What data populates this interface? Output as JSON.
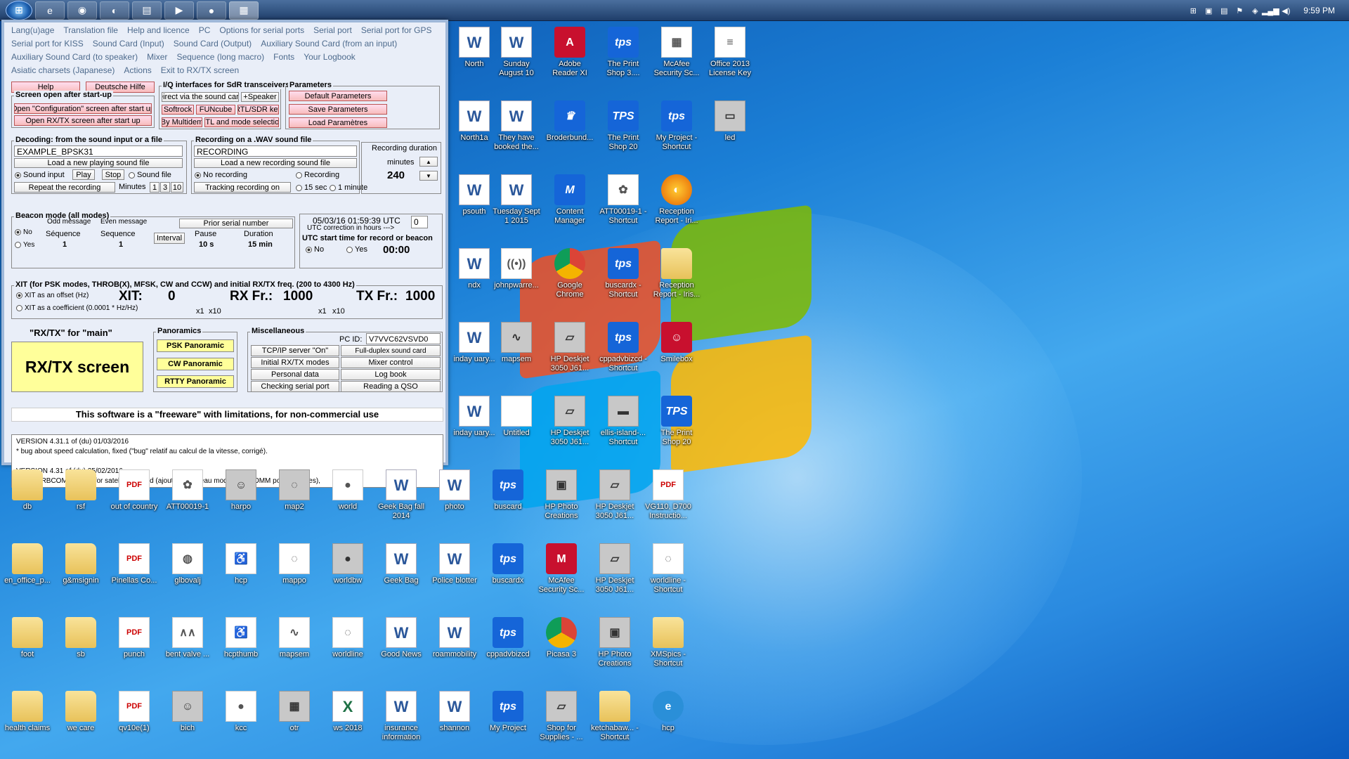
{
  "taskbar": {
    "start_glyph": "⊞",
    "buttons": [
      {
        "icon": "ie-icon",
        "glyph": "e"
      },
      {
        "icon": "chrome-icon",
        "glyph": "◉"
      },
      {
        "icon": "firefox-icon",
        "glyph": "◐"
      },
      {
        "icon": "explorer-icon",
        "glyph": "▤"
      },
      {
        "icon": "media-player-icon",
        "glyph": "▶"
      },
      {
        "icon": "disc-icon",
        "glyph": "●"
      },
      {
        "icon": "multipsk-icon",
        "glyph": "▦"
      }
    ],
    "clock": "9:59 PM"
  },
  "app": {
    "menu": [
      "Lang(u)age",
      "Translation file",
      "Help and licence",
      "PC",
      "Options for serial ports",
      "Serial port",
      "Serial port for GPS",
      "Serial port for KISS",
      "Sound Card (Input)",
      "Sound Card (Output)",
      "Auxiliary Sound Card (from an input)",
      "Auxiliary Sound Card (to speaker)",
      "Mixer",
      "Sequence (long macro)",
      "Fonts",
      "Your Logbook",
      "Asiatic charsets (Japanese)",
      "Actions",
      "Exit to RX/TX screen"
    ],
    "help": "Help",
    "deutsche": "Deutsche Hilfe",
    "screen_open": {
      "title": "Screen open after start-up",
      "config": "Open \"Configuration\" screen after start up",
      "rxtx": "Open RX/TX screen after start up"
    },
    "iq": {
      "title": "I/Q interfaces for SdR transceivers",
      "direct": "Direct via the sound card",
      "speaker": "+Speaker",
      "softrock": "Softrock",
      "funcube": "FUNcube",
      "rtl": "RTL/SDR key",
      "multidem": "By Multidem",
      "rtl_mode": "RTL and mode selection"
    },
    "params": {
      "title": "Parameters",
      "default": "Default Parameters",
      "save": "Save Parameters",
      "load": "Load Paramètres"
    },
    "decoding": {
      "title": "Decoding: from the sound input or a file",
      "file": "EXAMPLE_BPSK31",
      "load": "Load a new playing sound file",
      "sound_input": "Sound input",
      "play": "Play",
      "stop": "Stop",
      "sound_file": "Sound file",
      "repeat": "Repeat the recording",
      "minutes": "Minutes",
      "m1": "1",
      "m3": "3",
      "m10": "10"
    },
    "recording": {
      "title": "Recording on a .WAV sound file",
      "name": "RECORDING",
      "load": "Load a new recording sound file",
      "no_rec": "No recording",
      "rec": "Recording",
      "tracking": "Tracking recording on",
      "s15": "15 sec",
      "m1": "1 minute",
      "dur_label": "Recording duration",
      "minutes": "minutes",
      "value": "240"
    },
    "beacon": {
      "title": "Beacon mode (all modes)",
      "odd": "Odd message",
      "even": "Even message",
      "prior": "Prior serial number",
      "no": "No",
      "yes": "Yes",
      "seq1_label": "Séquence",
      "seq1": "1",
      "seq2_label": "Sequence",
      "seq2": "1",
      "interval": "Interval",
      "pause_label": "Pause",
      "pause": "10 s",
      "duration_label": "Duration",
      "duration": "15 min"
    },
    "utc": {
      "datetime": "05/03/16 01:59:39 UTC",
      "corr": "UTC correction in hours --->",
      "corr_val": "0",
      "start_title": "UTC start time for record or beacon",
      "no": "No",
      "yes": "Yes",
      "time": "00:00"
    },
    "xit": {
      "title": "XIT (for PSK modes, THROB(X), MFSK, CW and CCW) and initial RX/TX freq. (200 to 4300 Hz)",
      "offset": "XIT as an offset (Hz)",
      "coef": "XIT as a coefficient (0.0001 * Hz/Hz)",
      "xit_label": "XIT:",
      "xit_val": "0",
      "rx_label": "RX Fr.:",
      "rx_val": "1000",
      "tx_label": "TX Fr.:",
      "tx_val": "1000",
      "x1": "x1",
      "x10": "x10"
    },
    "rxtx": {
      "title": "\"RX/TX\" for \"main\"",
      "button": "RX/TX screen"
    },
    "panoramics": {
      "title": "Panoramics",
      "psk": "PSK Panoramic",
      "cw": "CW Panoramic",
      "rtty": "RTTY Panoramic"
    },
    "misc": {
      "title": "Miscellaneous",
      "pcid_label": "PC ID:",
      "pcid": "V7VVC62VSVD0",
      "tcp": "TCP/IP server \"On\"",
      "duplex": "Full-duplex sound card",
      "initial": "Initial RX/TX modes",
      "mixer": "Mixer control",
      "personal": "Personal data",
      "logbook": "Log book",
      "serial": "Checking serial port",
      "reading": "Reading a QSO"
    },
    "freeware": "This software is a \"freeware\" with limitations, for non-commercial use",
    "log": [
      "VERSION 4.31.1 of (du) 01/03/2016",
      "* bug about speed calculation, fixed (\"bug\" relatif au calcul de la vitesse, corrigé).",
      "",
      "VERSION 4.31 of (du) 25/02/2016",
      "* new ORBCOMM mode for satellites added (ajout du nouveau mode ORBCOMM pour satellites),"
    ]
  },
  "icons": [
    {
      "label": "North",
      "kind": "word",
      "glyph": "W",
      "name": "north-doc-icon"
    },
    {
      "label": "Sunday August 10",
      "kind": "word",
      "glyph": "W",
      "name": "sunday-august-doc-icon"
    },
    {
      "label": "Adobe Reader XI",
      "kind": "red",
      "glyph": "A",
      "name": "adobe-reader-icon"
    },
    {
      "label": "The Print Shop 3....",
      "kind": "tps",
      "glyph": "tps",
      "name": "print-shop-3-icon"
    },
    {
      "label": "McAfee Security Sc...",
      "kind": "doc",
      "glyph": "▦",
      "name": "mcafee-scan-icon"
    },
    {
      "label": "Office 2013 License Key",
      "kind": "doc",
      "glyph": "≡",
      "name": "office-license-icon"
    },
    {
      "label": "North1a",
      "kind": "word",
      "glyph": "W",
      "name": "north1a-doc-icon"
    },
    {
      "label": "They have booked the...",
      "kind": "word",
      "glyph": "W",
      "name": "booked-doc-icon"
    },
    {
      "label": "Broderbund...",
      "kind": "tps",
      "glyph": "♛",
      "name": "broderbund-icon"
    },
    {
      "label": "The Print Shop 20",
      "kind": "tps",
      "glyph": "TPS",
      "name": "print-shop-20-icon"
    },
    {
      "label": "My Project - Shortcut",
      "kind": "tps",
      "glyph": "tps",
      "name": "my-project-shortcut-icon"
    },
    {
      "label": "led",
      "kind": "img",
      "glyph": "▭",
      "name": "led-image-icon"
    },
    {
      "label": "psouth",
      "kind": "word",
      "glyph": "W",
      "name": "psouth-doc-icon"
    },
    {
      "label": "Tuesday Sept 1 2015",
      "kind": "word",
      "glyph": "W",
      "name": "tuesday-sept-doc-icon"
    },
    {
      "label": "Content Manager",
      "kind": "tps",
      "glyph": "M",
      "name": "content-manager-icon"
    },
    {
      "label": "ATT00019-1 - Shortcut",
      "kind": "doc",
      "glyph": "✿",
      "name": "att-shortcut-icon"
    },
    {
      "label": "Reception Report - Iri...",
      "kind": "ff",
      "glyph": "◐",
      "name": "reception-report-icon"
    },
    {
      "label": "ndx",
      "kind": "word",
      "glyph": "W",
      "name": "ndx-doc-icon"
    },
    {
      "label": "johnpwarre...",
      "kind": "doc",
      "glyph": "((•))",
      "name": "johnpwarre-icon"
    },
    {
      "label": "Google Chrome",
      "kind": "chrome",
      "glyph": "",
      "name": "google-chrome-icon"
    },
    {
      "label": "buscardx - Shortcut",
      "kind": "tps",
      "glyph": "tps",
      "name": "buscardx-shortcut-icon"
    },
    {
      "label": "Reception Report - Iris...",
      "kind": "folder",
      "glyph": "",
      "name": "reception-folder-icon"
    },
    {
      "label": "inday uary...",
      "kind": "word",
      "glyph": "W",
      "name": "inday-doc-icon"
    },
    {
      "label": "mapsem",
      "kind": "img",
      "glyph": "∿",
      "name": "mapsem-icon"
    },
    {
      "label": "HP Deskjet 3050 J61...",
      "kind": "img",
      "glyph": "▱",
      "name": "hp-deskjet-icon"
    },
    {
      "label": "cppadvbizcd - Shortcut",
      "kind": "tps",
      "glyph": "tps",
      "name": "cppadvbizcd-shortcut-icon"
    },
    {
      "label": "Smilebox",
      "kind": "red",
      "glyph": "☺",
      "name": "smilebox-icon"
    },
    {
      "label": "inday uary...",
      "kind": "word",
      "glyph": "W",
      "name": "inday2-doc-icon"
    },
    {
      "label": "Untitled",
      "kind": "doc",
      "glyph": "",
      "name": "untitled-icon"
    },
    {
      "label": "HP Deskjet 3050 J61...",
      "kind": "img",
      "glyph": "▱",
      "name": "hp-deskjet2-icon"
    },
    {
      "label": "ellis-island-... Shortcut",
      "kind": "img",
      "glyph": "▬",
      "name": "ellis-island-icon"
    },
    {
      "label": "The Print Shop 20",
      "kind": "tps",
      "glyph": "TPS",
      "name": "print-shop-20b-icon"
    },
    {
      "label": "db",
      "kind": "folder",
      "glyph": "",
      "name": "db-folder-icon"
    },
    {
      "label": "rsf",
      "kind": "folder",
      "glyph": "",
      "name": "rsf-folder-icon"
    },
    {
      "label": "out of country",
      "kind": "pdf",
      "glyph": "PDF",
      "name": "out-of-country-icon"
    },
    {
      "label": "ATT00019-1",
      "kind": "doc",
      "glyph": "✿",
      "name": "att-icon"
    },
    {
      "label": "harpo",
      "kind": "img",
      "glyph": "☺",
      "name": "harpo-icon"
    },
    {
      "label": "map2",
      "kind": "img",
      "glyph": "◌",
      "name": "map2-icon"
    },
    {
      "label": "world",
      "kind": "doc",
      "glyph": "●",
      "name": "world-icon"
    },
    {
      "label": "Geek Bag fall 2014",
      "kind": "word",
      "glyph": "W",
      "name": "geek-bag-fall-icon"
    },
    {
      "label": "photo",
      "kind": "word",
      "glyph": "W",
      "name": "photo-doc-icon"
    },
    {
      "label": "buscard",
      "kind": "tps",
      "glyph": "tps",
      "name": "buscard-icon"
    },
    {
      "label": "HP Photo Creations",
      "kind": "img",
      "glyph": "▣",
      "name": "hp-photo-icon"
    },
    {
      "label": "HP Deskjet 3050 J61...",
      "kind": "img",
      "glyph": "▱",
      "name": "hp-deskjet3-icon"
    },
    {
      "label": "VG110, D700 Instructio...",
      "kind": "pdf",
      "glyph": "PDF",
      "name": "vg110-icon"
    },
    {
      "label": "en_office_p...",
      "kind": "folder",
      "glyph": "",
      "name": "en-office-folder-icon"
    },
    {
      "label": "g&msignin",
      "kind": "folder",
      "glyph": "",
      "name": "gmsignin-folder-icon"
    },
    {
      "label": "Pinellas Co...",
      "kind": "pdf",
      "glyph": "PDF",
      "name": "pinellas-icon"
    },
    {
      "label": "glbovalj",
      "kind": "doc",
      "glyph": "◍",
      "name": "glbovalj-icon"
    },
    {
      "label": "hcp",
      "kind": "doc",
      "glyph": "♿",
      "name": "hcp-icon"
    },
    {
      "label": "mappo",
      "kind": "doc",
      "glyph": "◌",
      "name": "mappo-icon"
    },
    {
      "label": "worldbw",
      "kind": "img",
      "glyph": "●",
      "name": "worldbw-icon"
    },
    {
      "label": "Geek Bag",
      "kind": "word",
      "glyph": "W",
      "name": "geek-bag-icon"
    },
    {
      "label": "Police blotter",
      "kind": "word",
      "glyph": "W",
      "name": "police-blotter-icon"
    },
    {
      "label": "buscardx",
      "kind": "tps",
      "glyph": "tps",
      "name": "buscardx-icon"
    },
    {
      "label": "McAfee Security Sc...",
      "kind": "red",
      "glyph": "M",
      "name": "mcafee-icon"
    },
    {
      "label": "HP Deskjet 3050 J61...",
      "kind": "img",
      "glyph": "▱",
      "name": "hp-deskjet4-icon"
    },
    {
      "label": "worldline - Shortcut",
      "kind": "doc",
      "glyph": "◌",
      "name": "worldline-shortcut-icon"
    },
    {
      "label": "foot",
      "kind": "folder",
      "glyph": "",
      "name": "foot-folder-icon"
    },
    {
      "label": "sb",
      "kind": "folder",
      "glyph": "",
      "name": "sb-folder-icon"
    },
    {
      "label": "punch",
      "kind": "pdf",
      "glyph": "PDF",
      "name": "punch-icon"
    },
    {
      "label": "bent valve ...",
      "kind": "doc",
      "glyph": "∧∧",
      "name": "bent-valve-icon"
    },
    {
      "label": "hcpthumb",
      "kind": "doc",
      "glyph": "♿",
      "name": "hcpthumb-icon"
    },
    {
      "label": "mapsem",
      "kind": "doc",
      "glyph": "∿",
      "name": "mapsem2-icon"
    },
    {
      "label": "worldline",
      "kind": "doc",
      "glyph": "◌",
      "name": "worldline-icon"
    },
    {
      "label": "Good News",
      "kind": "word",
      "glyph": "W",
      "name": "good-news-icon"
    },
    {
      "label": "roammobility",
      "kind": "word",
      "glyph": "W",
      "name": "roammobility-icon"
    },
    {
      "label": "cppadvbizcd",
      "kind": "tps",
      "glyph": "tps",
      "name": "cppadvbizcd-icon"
    },
    {
      "label": "Picasa 3",
      "kind": "chrome",
      "glyph": "",
      "name": "picasa-icon"
    },
    {
      "label": "HP Photo Creations",
      "kind": "img",
      "glyph": "▣",
      "name": "hp-photo2-icon"
    },
    {
      "label": "XMSpics - Shortcut",
      "kind": "folder",
      "glyph": "",
      "name": "xmspics-folder-icon"
    },
    {
      "label": "health claims",
      "kind": "folder",
      "glyph": "",
      "name": "health-claims-folder-icon"
    },
    {
      "label": "we care",
      "kind": "folder",
      "glyph": "",
      "name": "we-care-folder-icon"
    },
    {
      "label": "qv10e(1)",
      "kind": "pdf",
      "glyph": "PDF",
      "name": "qv10e-icon"
    },
    {
      "label": "bich",
      "kind": "img",
      "glyph": "☺",
      "name": "bich-icon"
    },
    {
      "label": "kcc",
      "kind": "doc",
      "glyph": "●",
      "name": "kcc-icon"
    },
    {
      "label": "otr",
      "kind": "img",
      "glyph": "▦",
      "name": "otr-icon"
    },
    {
      "label": "ws 2018",
      "kind": "xls",
      "glyph": "X",
      "name": "ws2018-icon"
    },
    {
      "label": "insurance information",
      "kind": "word",
      "glyph": "W",
      "name": "insurance-icon"
    },
    {
      "label": "shannon",
      "kind": "word",
      "glyph": "W",
      "name": "shannon-icon"
    },
    {
      "label": "My Project",
      "kind": "tps",
      "glyph": "tps",
      "name": "my-project-icon"
    },
    {
      "label": "Shop for Supplies - ...",
      "kind": "img",
      "glyph": "▱",
      "name": "shop-supplies-icon"
    },
    {
      "label": "ketchabaw... - Shortcut",
      "kind": "folder",
      "glyph": "",
      "name": "ketchabaw-folder-icon"
    },
    {
      "label": "hcp",
      "kind": "ie",
      "glyph": "e",
      "name": "hcp-ie-icon"
    }
  ]
}
